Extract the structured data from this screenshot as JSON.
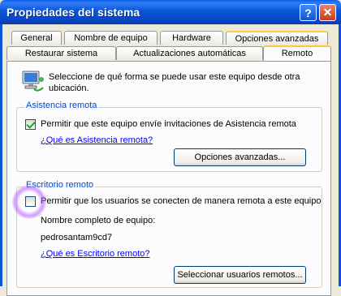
{
  "window": {
    "title": "Propiedades del sistema",
    "help_label": "?",
    "close_label": "✕"
  },
  "tabs": {
    "row_back": [
      {
        "label": "General"
      },
      {
        "label": "Nombre de equipo"
      },
      {
        "label": "Hardware"
      },
      {
        "label": "Opciones avanzadas"
      }
    ],
    "row_front": [
      {
        "label": "Restaurar sistema"
      },
      {
        "label": "Actualizaciones automáticas"
      },
      {
        "label": "Remoto",
        "active": true
      }
    ]
  },
  "remote": {
    "icon": "computer-network-icon",
    "intro": "Seleccione de qué forma se puede usar este equipo desde otra ubicación.",
    "assistance": {
      "title": "Asistencia remota",
      "checkbox_label": "Permitir que este equipo envíe invitaciones de Asistencia remota",
      "checked": true,
      "help_link": "¿Qué es Asistencia remota?",
      "advanced_button": "Opciones avanzadas..."
    },
    "desktop": {
      "title": "Escritorio remoto",
      "checkbox_label": "Permitir que los usuarios se conecten de manera remota a este equipo",
      "checked": false,
      "computer_name_label": "Nombre completo de equipo:",
      "computer_name": "pedrosantam9cd7",
      "help_link": "¿Qué es Escritorio remoto?",
      "select_users_button": "Seleccionar usuarios remotos..."
    }
  },
  "colors": {
    "titlebar": "#0a55d8",
    "group_title": "#0046d5",
    "link": "#0000ff",
    "highlight": "#b45aff"
  }
}
